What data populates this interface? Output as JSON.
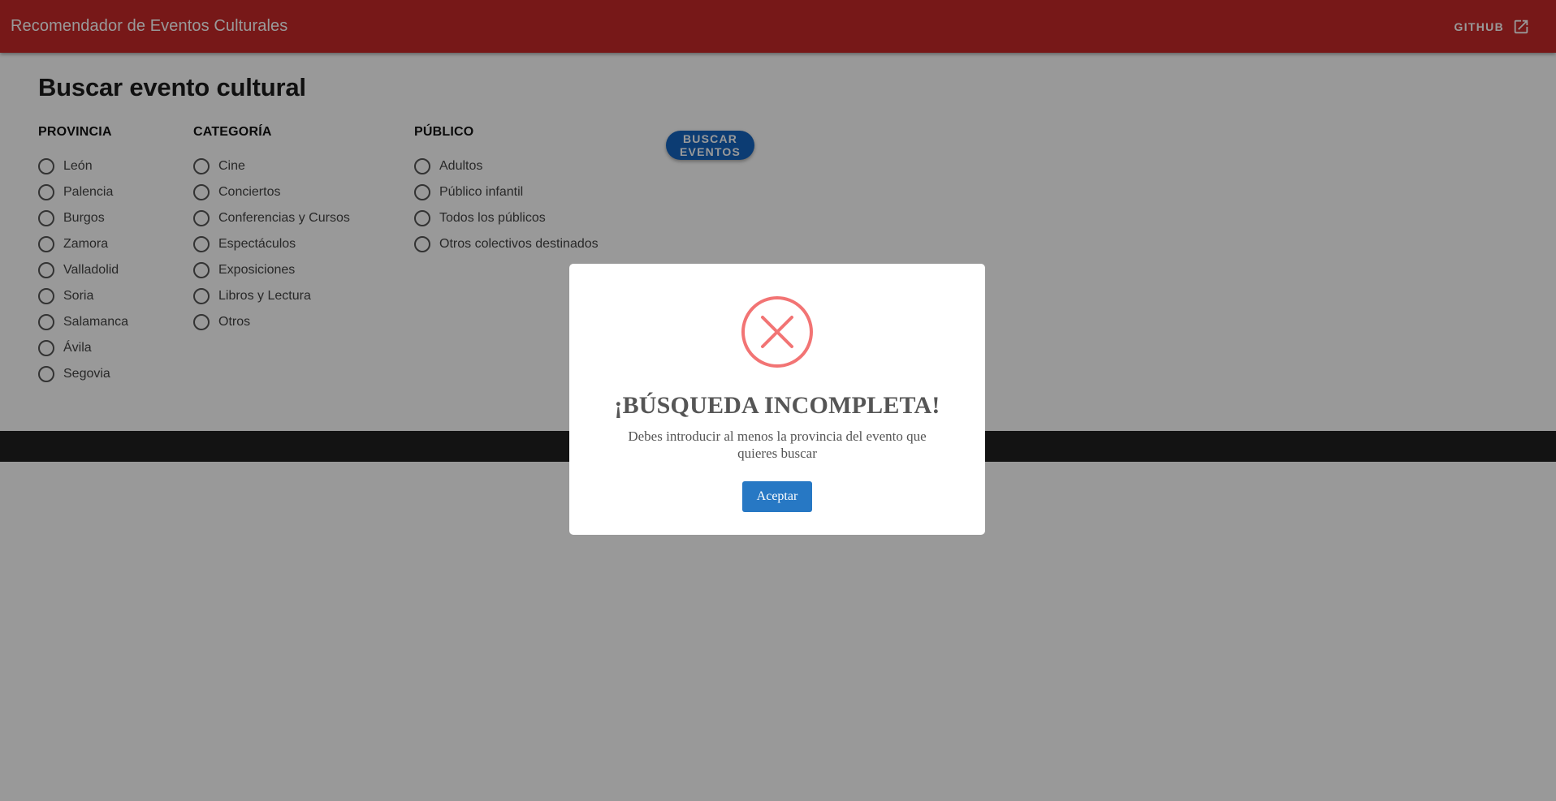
{
  "header": {
    "title": "Recomendador de Eventos Culturales",
    "github_label": "GITHUB",
    "github_icon": "open-in-new-icon"
  },
  "main": {
    "title": "Buscar evento cultural",
    "search_button": "BUSCAR EVENTOS"
  },
  "filters": {
    "provincia": {
      "label": "PROVINCIA",
      "options": [
        "León",
        "Palencia",
        "Burgos",
        "Zamora",
        "Valladolid",
        "Soria",
        "Salamanca",
        "Ávila",
        "Segovia"
      ]
    },
    "categoria": {
      "label": "CATEGORÍA",
      "options": [
        "Cine",
        "Conciertos",
        "Conferencias y Cursos",
        "Espectáculos",
        "Exposiciones",
        "Libros y Lectura",
        "Otros"
      ]
    },
    "publico": {
      "label": "PÚBLICO",
      "options": [
        "Adultos",
        "Público infantil",
        "Todos los públicos",
        "Otros colectivos destinados"
      ]
    }
  },
  "modal": {
    "icon": "error-x-icon",
    "title": "¡BÚSQUEDA INCOMPLETA!",
    "text": "Debes introducir al menos la provincia del evento que quieres buscar",
    "confirm_label": "Aceptar"
  },
  "colors": {
    "primary": "#c62828",
    "button_blue": "#1565c0",
    "modal_button": "#2778c4",
    "error_icon": "#f27474",
    "footer": "#212121"
  }
}
